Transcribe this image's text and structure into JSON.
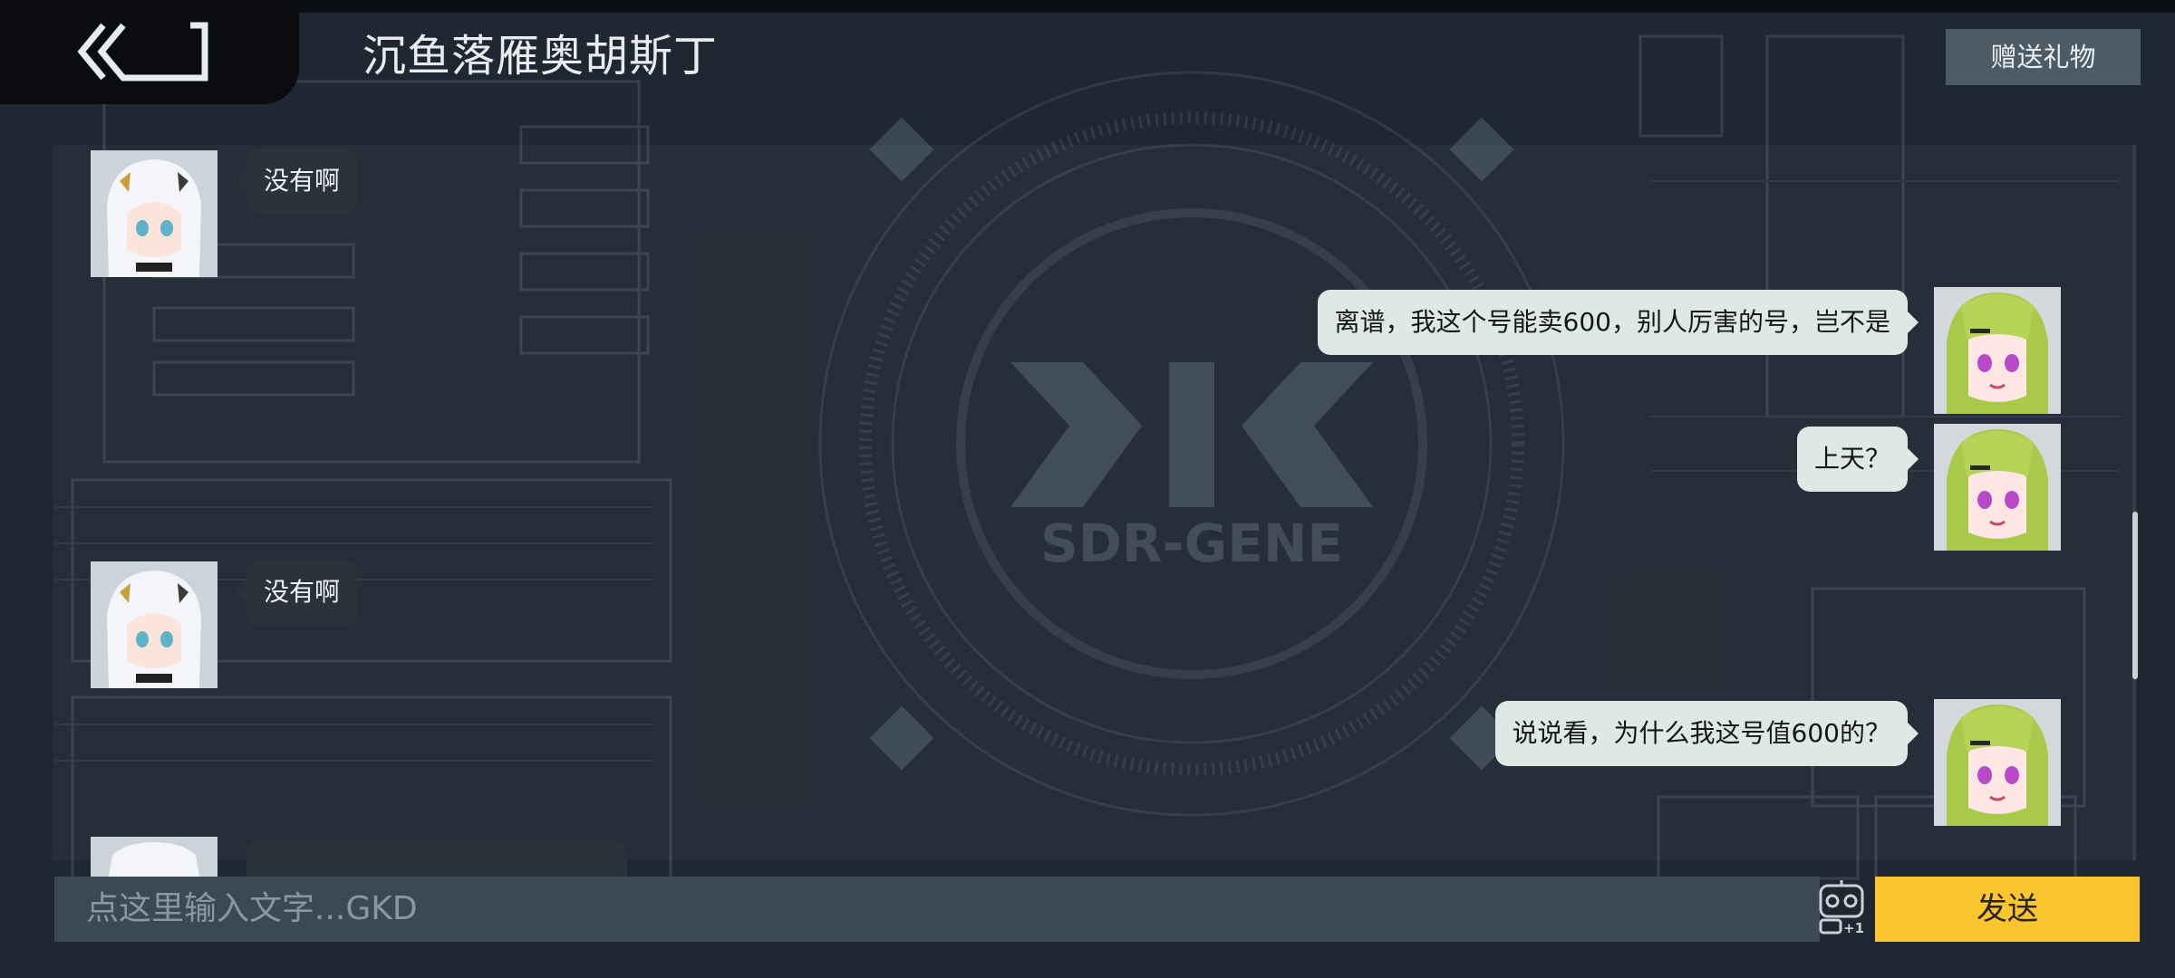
{
  "header": {
    "title": "沉鱼落雁奥胡斯丁",
    "gift_label": "赠送礼物",
    "back_icon": "double-chevron-back-icon"
  },
  "background": {
    "logo_text": "SDR-GENE"
  },
  "messages": [
    {
      "side": "left",
      "text": "没有啊"
    },
    {
      "side": "right",
      "text": "离谱，我这个号能卖600，别人厉害的号，岂不是"
    },
    {
      "side": "right",
      "text": "上天？"
    },
    {
      "side": "left",
      "text": "没有啊"
    },
    {
      "side": "right",
      "text": "说说看，为什么我这号值600的？"
    }
  ],
  "input": {
    "placeholder": "点这里输入文字...GKD",
    "emoji_badge": "+1",
    "send_label": "发送"
  },
  "colors": {
    "send": "#fbc52f",
    "bubble_right": "#dfe9e4",
    "bubble_left": "#2a323b",
    "background": "#1f2732"
  }
}
